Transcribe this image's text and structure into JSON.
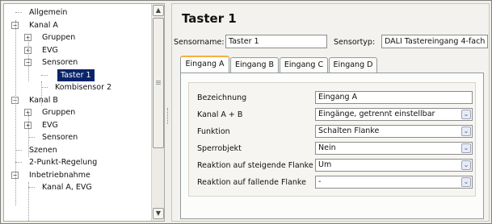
{
  "tree": {
    "items": [
      {
        "label": "Allgemein",
        "level": 0,
        "expander": ""
      },
      {
        "label": "Kanal A",
        "level": 0,
        "expander": "−"
      },
      {
        "label": "Gruppen",
        "level": 1,
        "expander": "+"
      },
      {
        "label": "EVG",
        "level": 1,
        "expander": "+"
      },
      {
        "label": "Sensoren",
        "level": 1,
        "expander": "−"
      },
      {
        "label": "Taster 1",
        "level": 2,
        "expander": "",
        "selected": true
      },
      {
        "label": "Kombisensor 2",
        "level": 2,
        "expander": ""
      },
      {
        "label": "Kanal B",
        "level": 0,
        "expander": "−"
      },
      {
        "label": "Gruppen",
        "level": 1,
        "expander": "+"
      },
      {
        "label": "EVG",
        "level": 1,
        "expander": "+"
      },
      {
        "label": "Sensoren",
        "level": 1,
        "expander": ""
      },
      {
        "label": "Szenen",
        "level": 0,
        "expander": ""
      },
      {
        "label": "2-Punkt-Regelung",
        "level": 0,
        "expander": ""
      },
      {
        "label": "Inbetriebnahme",
        "level": 0,
        "expander": "−"
      },
      {
        "label": "Kanal A, EVG",
        "level": 1,
        "expander": ""
      }
    ],
    "scroll_up_icon": "chevron-up-icon",
    "scroll_down_icon": "chevron-down-icon"
  },
  "panel": {
    "title": "Taster 1",
    "sensorname_label": "Sensorname:",
    "sensorname_value": "Taster 1",
    "sensortyp_label": "Sensortyp:",
    "sensortyp_value": "DALI Tastereingang 4-fach"
  },
  "tabs": [
    "Eingang A",
    "Eingang B",
    "Eingang C",
    "Eingang D"
  ],
  "active_tab": 0,
  "form": {
    "rows": [
      {
        "label": "Bezeichnung",
        "value": "Eingang A",
        "type": "text"
      },
      {
        "label": "Kanal A + B",
        "value": "Eingänge, getrennt einstellbar",
        "type": "select"
      },
      {
        "label": "Funktion",
        "value": "Schalten Flanke",
        "type": "select"
      },
      {
        "label": "Sperrobjekt",
        "value": "Nein",
        "type": "select"
      },
      {
        "label": "Reaktion auf steigende Flanke",
        "value": "Um",
        "type": "select"
      },
      {
        "label": "Reaktion auf fallende Flanke",
        "value": "-",
        "type": "select"
      }
    ]
  },
  "colors": {
    "selection": "#0a246a",
    "active_tab_accent": "#f5b041"
  }
}
